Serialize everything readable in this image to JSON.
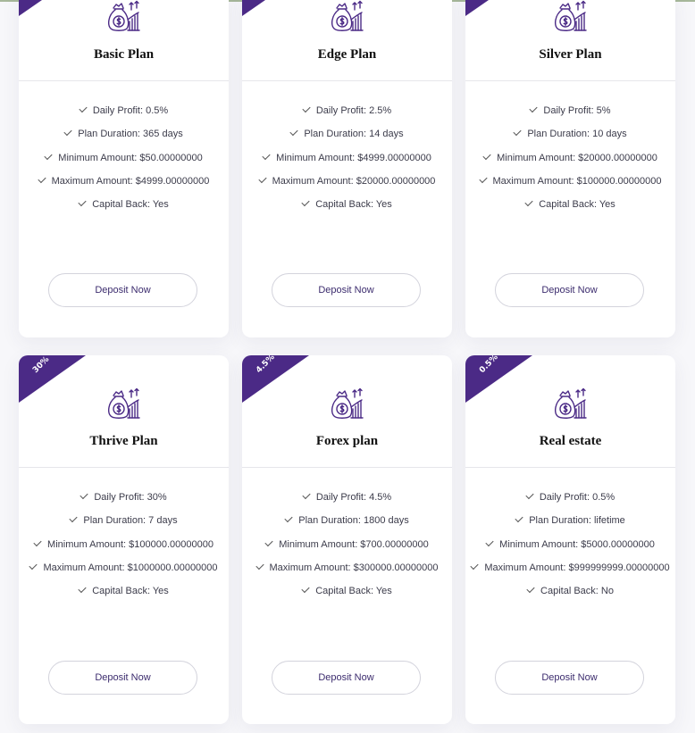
{
  "colors": {
    "ribbon": "#4b2a86",
    "icon": "#4b2a86",
    "button_text": "#3c2c6e",
    "card_bg": "#ffffff"
  },
  "icons": {
    "plan": "money-bag-growth-icon",
    "feature": "check-icon"
  },
  "plans": [
    {
      "name": "Basic Plan",
      "ribbon": "",
      "features": [
        "Daily Profit: 0.5%",
        "Plan Duration: 365 days",
        "Minimum Amount: $50.00000000",
        "Maximum Amount: $4999.00000000",
        "Capital Back: Yes"
      ],
      "button": "Deposit Now"
    },
    {
      "name": "Edge Plan",
      "ribbon": "",
      "features": [
        "Daily Profit: 2.5%",
        "Plan Duration: 14 days",
        "Minimum Amount: $4999.00000000",
        "Maximum Amount: $20000.00000000",
        "Capital Back: Yes"
      ],
      "button": "Deposit Now"
    },
    {
      "name": "Silver Plan",
      "ribbon": "",
      "features": [
        "Daily Profit: 5%",
        "Plan Duration: 10 days",
        "Minimum Amount: $20000.00000000",
        "Maximum Amount: $100000.00000000",
        "Capital Back: Yes"
      ],
      "button": "Deposit Now"
    },
    {
      "name": "Thrive Plan",
      "ribbon": "30%",
      "features": [
        "Daily Profit: 30%",
        "Plan Duration: 7 days",
        "Minimum Amount: $100000.00000000",
        "Maximum Amount: $1000000.00000000",
        "Capital Back: Yes"
      ],
      "button": "Deposit Now"
    },
    {
      "name": "Forex plan",
      "ribbon": "4.5%",
      "features": [
        "Daily Profit: 4.5%",
        "Plan Duration: 1800 days",
        "Minimum Amount: $700.00000000",
        "Maximum Amount: $300000.00000000",
        "Capital Back: Yes"
      ],
      "button": "Deposit Now"
    },
    {
      "name": "Real estate",
      "ribbon": "0.5%",
      "features": [
        "Daily Profit: 0.5%",
        "Plan Duration: lifetime",
        "Minimum Amount: $5000.00000000",
        "Maximum Amount: $999999999.00000000",
        "Capital Back: No"
      ],
      "button": "Deposit Now"
    }
  ]
}
